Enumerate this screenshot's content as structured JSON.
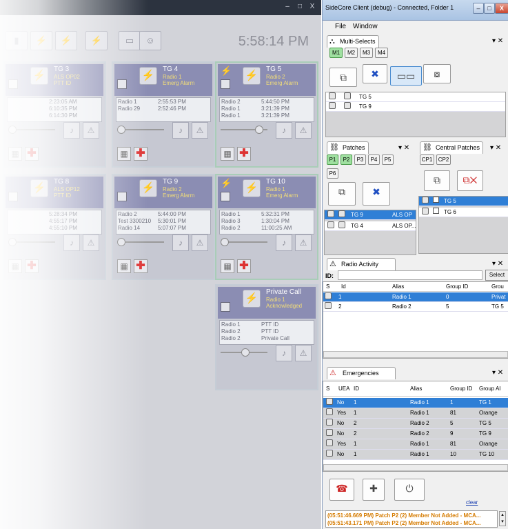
{
  "console": {
    "clock": "5:58:14 PM",
    "window_controls": [
      "–",
      "□",
      "X"
    ],
    "tiles": [
      {
        "name": "TG 3",
        "sub": [
          "ALS OP02",
          "PTT ID"
        ],
        "rows": [
          [
            "",
            "2:23:05 AM"
          ],
          [
            "",
            "6:10:35 PM"
          ],
          [
            "",
            "6:14:30 PM"
          ]
        ]
      },
      {
        "name": "TG 4",
        "sub": [
          "Radio 1",
          "Emerg Alarm"
        ],
        "rows": [
          [
            "Radio 1",
            "2:55:53 PM"
          ],
          [
            "Radio 29",
            "2:52:46 PM"
          ]
        ]
      },
      {
        "name": "TG 5",
        "sub": [
          "Radio 2",
          "Emerg Alarm"
        ],
        "rows": [
          [
            "Radio 2",
            "5:44:50 PM"
          ],
          [
            "Radio 1",
            "3:21:39 PM"
          ],
          [
            "Radio 1",
            "3:21:39 PM"
          ]
        ]
      },
      {
        "name": "TG 8",
        "sub": [
          "ALS OP12",
          "PTT ID"
        ],
        "rows": [
          [
            "",
            "5:28:34 PM"
          ],
          [
            "",
            "4:55:17 PM"
          ],
          [
            "",
            "4:55:10 PM"
          ]
        ]
      },
      {
        "name": "TG 9",
        "sub": [
          "Radio 2",
          "Emerg Alarm"
        ],
        "rows": [
          [
            "Radio 2",
            "5:44:00 PM"
          ],
          [
            "Test 3300210",
            "5:30:01 PM"
          ],
          [
            "Radio 14",
            "5:07:07 PM"
          ]
        ]
      },
      {
        "name": "TG 10",
        "sub": [
          "Radio 1",
          "Emerg Alarm"
        ],
        "rows": [
          [
            "Radio 1",
            "5:32:31 PM"
          ],
          [
            "Radio 3",
            "1:30:04 PM"
          ],
          [
            "Radio 2",
            "11:00:25 AM"
          ]
        ]
      },
      {
        "name": "Private Call",
        "sub": [
          "Radio 1",
          "Acknowledged"
        ],
        "rows": [
          [
            "Radio 1",
            "PTT ID"
          ],
          [
            "Radio 2",
            "PTT ID"
          ],
          [
            "Radio 2",
            "Private Call"
          ]
        ]
      }
    ]
  },
  "window": {
    "title": "SideCore Client (debug) - Connected, Folder 1",
    "controls": [
      "–",
      "□",
      "X"
    ],
    "menu": [
      "File",
      "Window"
    ]
  },
  "multiselects": {
    "tab": "Multi-Selects",
    "controls": "▾ ✕",
    "tabs": [
      "M1",
      "M2",
      "M3",
      "M4"
    ],
    "items": [
      "TG 5",
      "TG 9"
    ]
  },
  "patches": {
    "tab": "Patches",
    "controls": "▾ ✕",
    "tabs": [
      "P1",
      "P2",
      "P3",
      "P4",
      "P5",
      "P6"
    ],
    "rows": [
      [
        "TG 9",
        "ALS OP"
      ],
      [
        "TG 4",
        "ALS OP..."
      ]
    ]
  },
  "central_patches": {
    "tab": "Central Patches",
    "controls": "▾ ✕",
    "tabs": [
      "CP1",
      "CP2"
    ],
    "rows": [
      "TG 5",
      "TG 6"
    ]
  },
  "radio_activity": {
    "tab": "Radio Activity",
    "controls": "▾ ✕",
    "id_label": "ID:",
    "select_label": "Select",
    "columns": [
      "S",
      "Id",
      "Alias",
      "Group ID",
      "Grou"
    ],
    "rows": [
      [
        "1",
        "Radio 1",
        "0",
        "Privat"
      ],
      [
        "2",
        "Radio 2",
        "5",
        "TG 5"
      ]
    ]
  },
  "emergencies": {
    "tab": "Emergencies",
    "controls": "▾ ✕",
    "columns": [
      "S",
      "UEA",
      "ID",
      "Alias",
      "Group ID",
      "Group Al"
    ],
    "rows": [
      [
        "No",
        "1",
        "Radio 1",
        "1",
        "TG 1"
      ],
      [
        "Yes",
        "1",
        "Radio 1",
        "81",
        "Orange"
      ],
      [
        "No",
        "2",
        "Radio 2",
        "5",
        "TG 5"
      ],
      [
        "No",
        "2",
        "Radio 2",
        "9",
        "TG 9"
      ],
      [
        "Yes",
        "1",
        "Radio 1",
        "81",
        "Orange"
      ],
      [
        "No",
        "1",
        "Radio 1",
        "10",
        "TG 10"
      ]
    ],
    "clear_label": "clear"
  },
  "log": [
    "(05:51:46.669 PM) Patch P2 (2) Member Not Added - MCA...",
    "(05:51:43.171 PM) Patch P2 (2) Member Not Added - MCA..."
  ]
}
